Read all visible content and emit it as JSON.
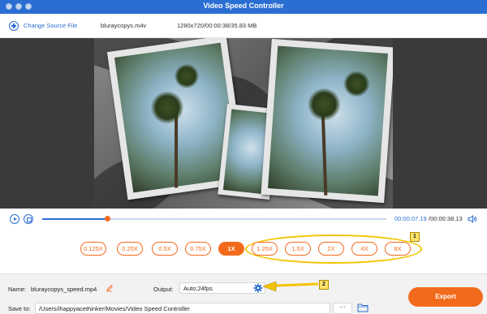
{
  "window": {
    "title": "Video Speed Controller"
  },
  "toolbar": {
    "change_source_label": "Change Source File",
    "source_filename": "bluraycopys.m4v",
    "source_meta": "1280x720/00:00:38/35.83 MB"
  },
  "playback": {
    "current_time": "00:00:07.19",
    "total_time": "/00:00:38.13",
    "progress": 0.19
  },
  "speeds": {
    "options": [
      "0.125X",
      "0.25X",
      "0.5X",
      "0.75X",
      "1X",
      "1.25X",
      "1.5X",
      "2X",
      "4X",
      "8X"
    ],
    "selected": "1X"
  },
  "annotations": {
    "badge_1": "1",
    "badge_2": "2",
    "highlight_color": "#f2c400"
  },
  "output_panel": {
    "name_label": "Name:",
    "name_value": "bluraycopys_speed.mp4",
    "output_label": "Output:",
    "output_value": "Auto;24fps",
    "save_to_label": "Save to:",
    "save_to_path": "/Users/ihappyacethinker/Movies/Video Speed Controller",
    "browse_label": "···",
    "export_label": "Export"
  },
  "colors": {
    "accent_blue": "#2b6ed3",
    "accent_orange": "#f26b1d"
  }
}
